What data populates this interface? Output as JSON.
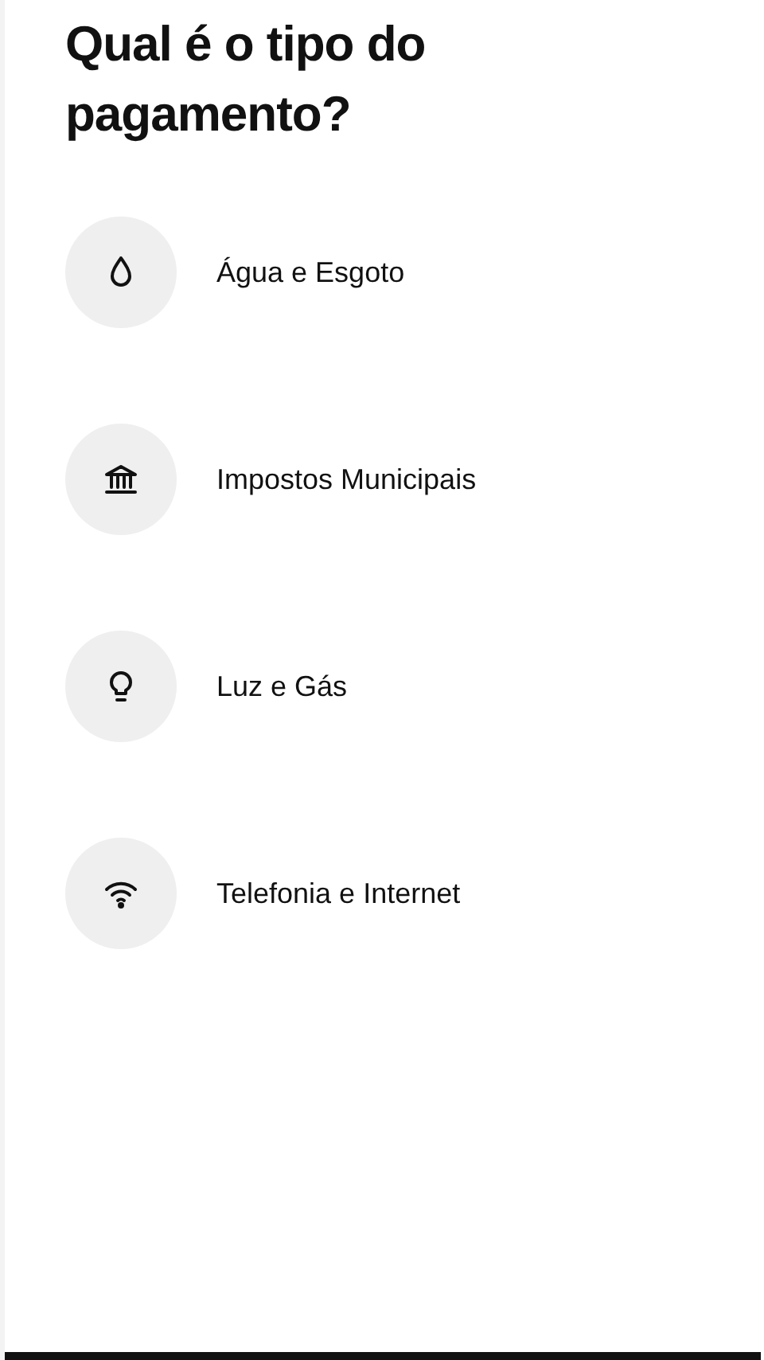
{
  "title": "Qual é o tipo do pagamento?",
  "options": [
    {
      "kind": "water",
      "label": "Água e Esgoto"
    },
    {
      "kind": "bank",
      "label": "Impostos Municipais"
    },
    {
      "kind": "bulb",
      "label": "Luz e Gás"
    },
    {
      "kind": "wifi",
      "label": "Telefonia e Internet"
    }
  ]
}
